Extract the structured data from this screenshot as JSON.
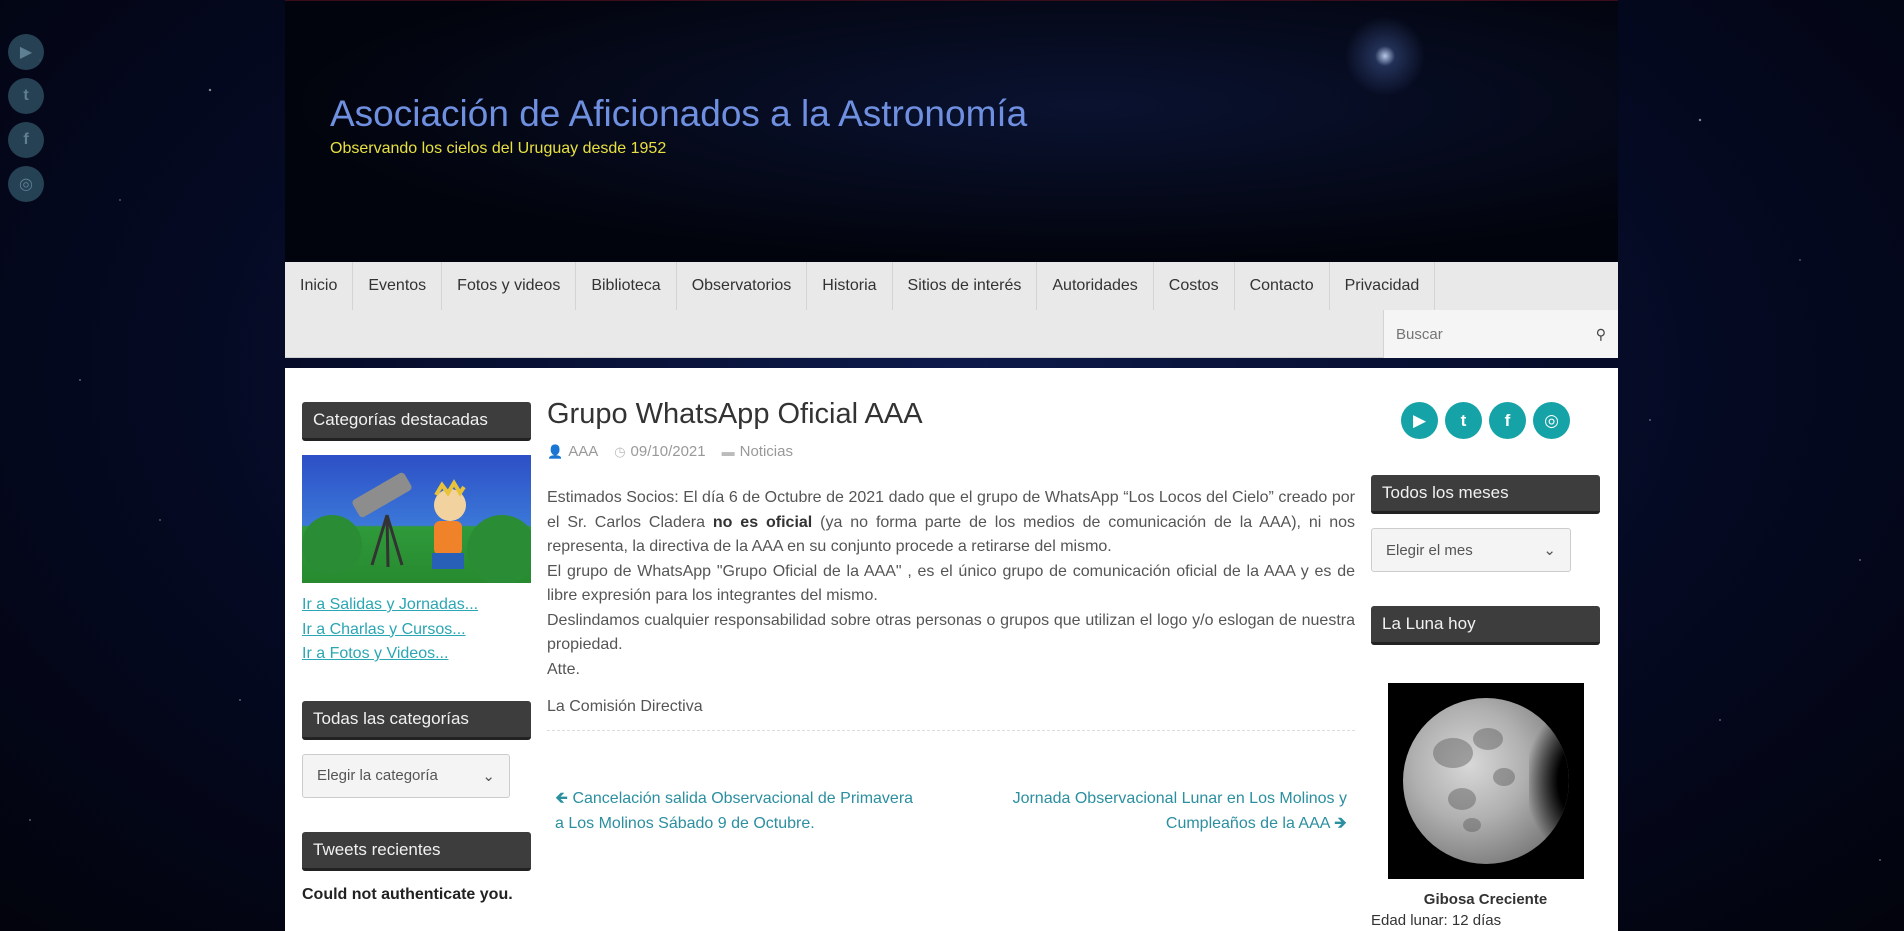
{
  "site": {
    "title": "Asociación de Aficionados a la Astronomía",
    "tagline": "Observando los cielos del Uruguay desde 1952"
  },
  "nav": {
    "items": [
      "Inicio",
      "Eventos",
      "Fotos y videos",
      "Biblioteca",
      "Observatorios",
      "Historia",
      "Sitios de interés",
      "Autoridades",
      "Costos",
      "Contacto",
      "Privacidad"
    ],
    "search_placeholder": "Buscar"
  },
  "left_sidebar": {
    "featured_title": "Categorías destacadas",
    "links": [
      "Ir a Salidas y Jornadas...",
      "Ir a Charlas y Cursos...",
      "Ir a Fotos y Videos..."
    ],
    "all_categories_title": "Todas las categorías",
    "category_select": "Elegir la categoría",
    "tweets_title": "Tweets recientes",
    "tweets_message": "Could not authenticate you."
  },
  "post": {
    "title": "Grupo WhatsApp Oficial AAA",
    "author": "AAA",
    "date": "09/10/2021",
    "category": "Noticias",
    "p1_a": "Estimados Socios: El día 6 de Octubre de 2021 dado que el grupo de WhatsApp “Los Locos del Cielo” creado por el Sr. Carlos Cladera ",
    "p1_bold": "no es oficial",
    "p1_b": " (ya no forma parte de los medios de comunicación de la AAA), ni nos representa, la directiva de la AAA en su conjunto procede a retirarse del mismo.",
    "p2": "El grupo de WhatsApp \"Grupo Oficial de la AAA\" , es el único grupo de comunicación oficial de la AAA y es de libre expresión para los integrantes del mismo.",
    "p3": "Deslindamos cualquier responsabilidad sobre otras personas o grupos que utilizan el logo y/o eslogan de nuestra propiedad.",
    "p4": "Atte.",
    "signature": "La Comisión Directiva",
    "prev_link": "Cancelación salida Observacional de Primavera a Los Molinos Sábado 9 de Octubre.",
    "next_link": "Jornada Observacional Lunar en Los Molinos y Cumpleaños de la AAA"
  },
  "right_sidebar": {
    "social_icons": [
      "youtube-icon",
      "twitter-icon",
      "facebook-icon",
      "instagram-icon"
    ],
    "months_title": "Todos los meses",
    "month_select": "Elegir el mes",
    "moon_title": "La Luna hoy",
    "moon_phase": "Gibosa Creciente",
    "moon_age": "Edad lunar: 12 días"
  },
  "colors": {
    "accent": "#15a3a8",
    "link": "#2ba6b4",
    "title_blue": "#6f8fe0",
    "tagline_yellow": "#e8e040"
  }
}
